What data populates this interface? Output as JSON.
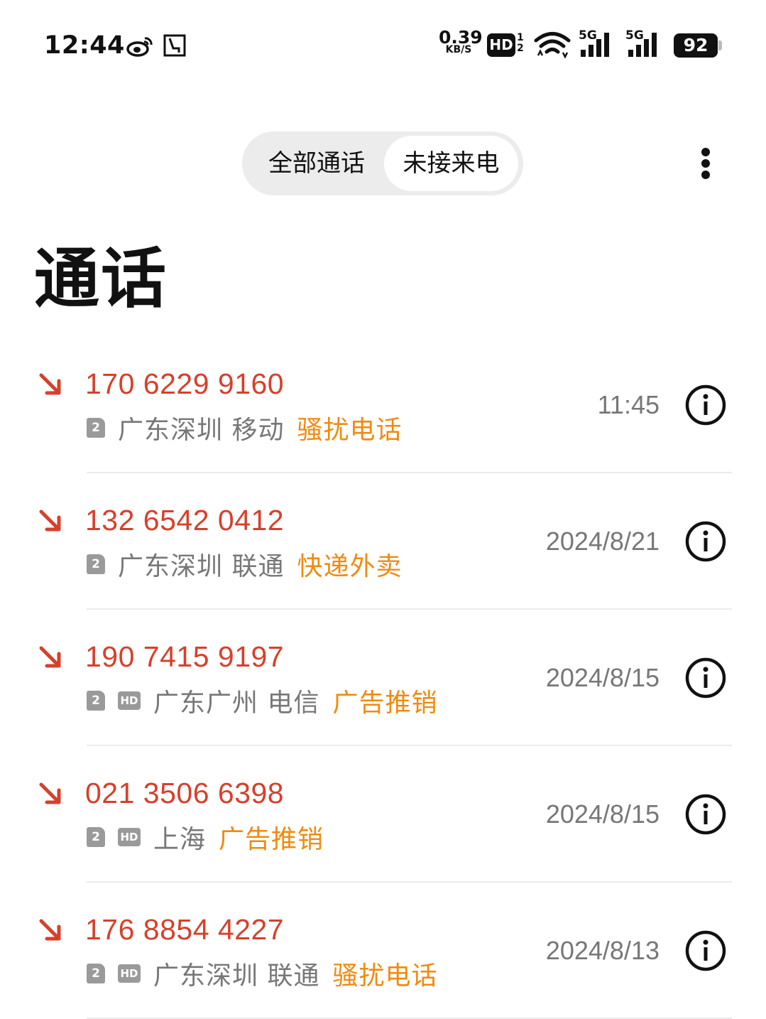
{
  "status_bar": {
    "time": "12:44",
    "net_speed_value": "0.39",
    "net_speed_unit": "KB/S",
    "hd_label": "HD",
    "hd_sub_top": "1",
    "hd_sub_bottom": "2",
    "signal1_label": "5G",
    "signal2_label": "5G",
    "battery": "92"
  },
  "tabs": {
    "all_label": "全部通话",
    "missed_label": "未接来电"
  },
  "page_title": "通话",
  "accent_colors": {
    "missed_number": "#d6402b",
    "tag": "#f08a10"
  },
  "calls": [
    {
      "number": "170 6229 9160",
      "sim": "2",
      "hd": "",
      "location": "广东深圳 移动",
      "tag": "骚扰电话",
      "date": "11:45"
    },
    {
      "number": "132 6542 0412",
      "sim": "2",
      "hd": "",
      "location": "广东深圳 联通",
      "tag": "快递外卖",
      "date": "2024/8/21"
    },
    {
      "number": "190 7415 9197",
      "sim": "2",
      "hd": "HD",
      "location": "广东广州 电信",
      "tag": "广告推销",
      "date": "2024/8/15"
    },
    {
      "number": "021 3506 6398",
      "sim": "2",
      "hd": "HD",
      "location": "上海",
      "tag": "广告推销",
      "date": "2024/8/15"
    },
    {
      "number": "176 8854 4227",
      "sim": "2",
      "hd": "HD",
      "location": "广东深圳 联通",
      "tag": "骚扰电话",
      "date": "2024/8/13"
    }
  ]
}
